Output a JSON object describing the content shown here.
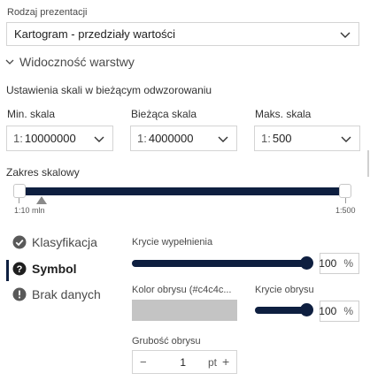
{
  "presentation": {
    "label": "Rodzaj prezentacji",
    "value": "Kartogram - przedziały wartości"
  },
  "visibility": {
    "title": "Widoczność warstwy",
    "scale_settings_label": "Ustawienia skali w bieżącym odwzorowaniu",
    "min": {
      "label": "Min. skala",
      "prefix": "1:",
      "value": "10000000"
    },
    "current": {
      "label": "Bieżąca skala",
      "prefix": "1:",
      "value": "4000000"
    },
    "max": {
      "label": "Maks. skala",
      "prefix": "1:",
      "value": "500"
    },
    "range_label": "Zakres skalowy",
    "range_left": "1:10 mln",
    "range_right": "1:500"
  },
  "side_nav": {
    "items": [
      {
        "label": "Klasyfikacja",
        "icon": "check-circle-icon"
      },
      {
        "label": "Symbol",
        "icon": "question-circle-icon",
        "active": true
      },
      {
        "label": "Brak danych",
        "icon": "info-circle-icon"
      }
    ]
  },
  "symbol": {
    "fill_opacity_label": "Krycie wypełnienia",
    "fill_opacity_value": "100",
    "outline_color_label": "Kolor obrysu (#c4c4c...",
    "outline_color": "#c4c4c4",
    "outline_opacity_label": "Krycie obrysu",
    "outline_opacity_value": "100",
    "percent": "%",
    "outline_width_label": "Grubość obrysu",
    "outline_width_value": "1",
    "outline_width_unit": "pt",
    "minus": "−",
    "plus": "+"
  },
  "colors": {
    "accent": "#0e1f40"
  }
}
